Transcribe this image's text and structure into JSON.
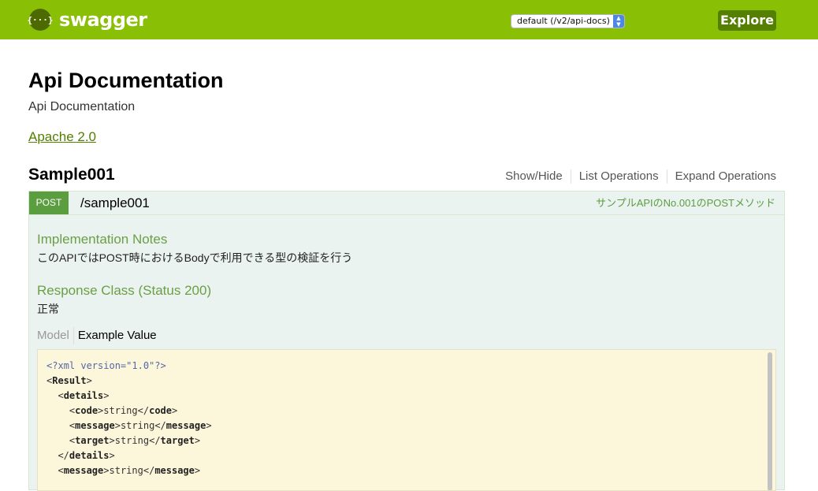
{
  "header": {
    "logo_symbol": "{···}",
    "logo_text": "swagger",
    "api_selector_value": "default (/v2/api-docs)",
    "explore_label": "Explore",
    "bg_color": "#89bf04"
  },
  "info": {
    "title": "Api Documentation",
    "description": "Api Documentation",
    "license_link": "Apache 2.0"
  },
  "resource": {
    "title": "Sample001",
    "actions": [
      "Show/Hide",
      "List Operations",
      "Expand Operations"
    ]
  },
  "operation": {
    "method": "POST",
    "path": "/sample001",
    "summary": "サンプルAPIのNo.001のPOSTメソッド",
    "implementation_notes_heading": "Implementation Notes",
    "implementation_notes": "このAPIではPOST時におけるBodyで利用できる型の検証を行う",
    "response_class_heading": "Response Class (Status 200)",
    "response_class_text": "正常",
    "tabs": [
      "Model",
      "Example Value"
    ],
    "method_color": "#5b9e40"
  },
  "example_xml": {
    "declaration": "<?xml version=\"1.0\"?>",
    "lines": [
      {
        "indent": "",
        "open": "<Result>",
        "text": "",
        "close": ""
      },
      {
        "indent": "  ",
        "open": "<details>",
        "text": "",
        "close": ""
      },
      {
        "indent": "    ",
        "open": "<code>",
        "text": "string",
        "close": "</code>"
      },
      {
        "indent": "    ",
        "open": "<message>",
        "text": "string",
        "close": "</message>"
      },
      {
        "indent": "    ",
        "open": "<target>",
        "text": "string",
        "close": "</target>"
      },
      {
        "indent": "  ",
        "open": "",
        "text": "",
        "close": "</details>"
      },
      {
        "indent": "  ",
        "open": "<message>",
        "text": "string",
        "close": "</message>"
      }
    ]
  }
}
